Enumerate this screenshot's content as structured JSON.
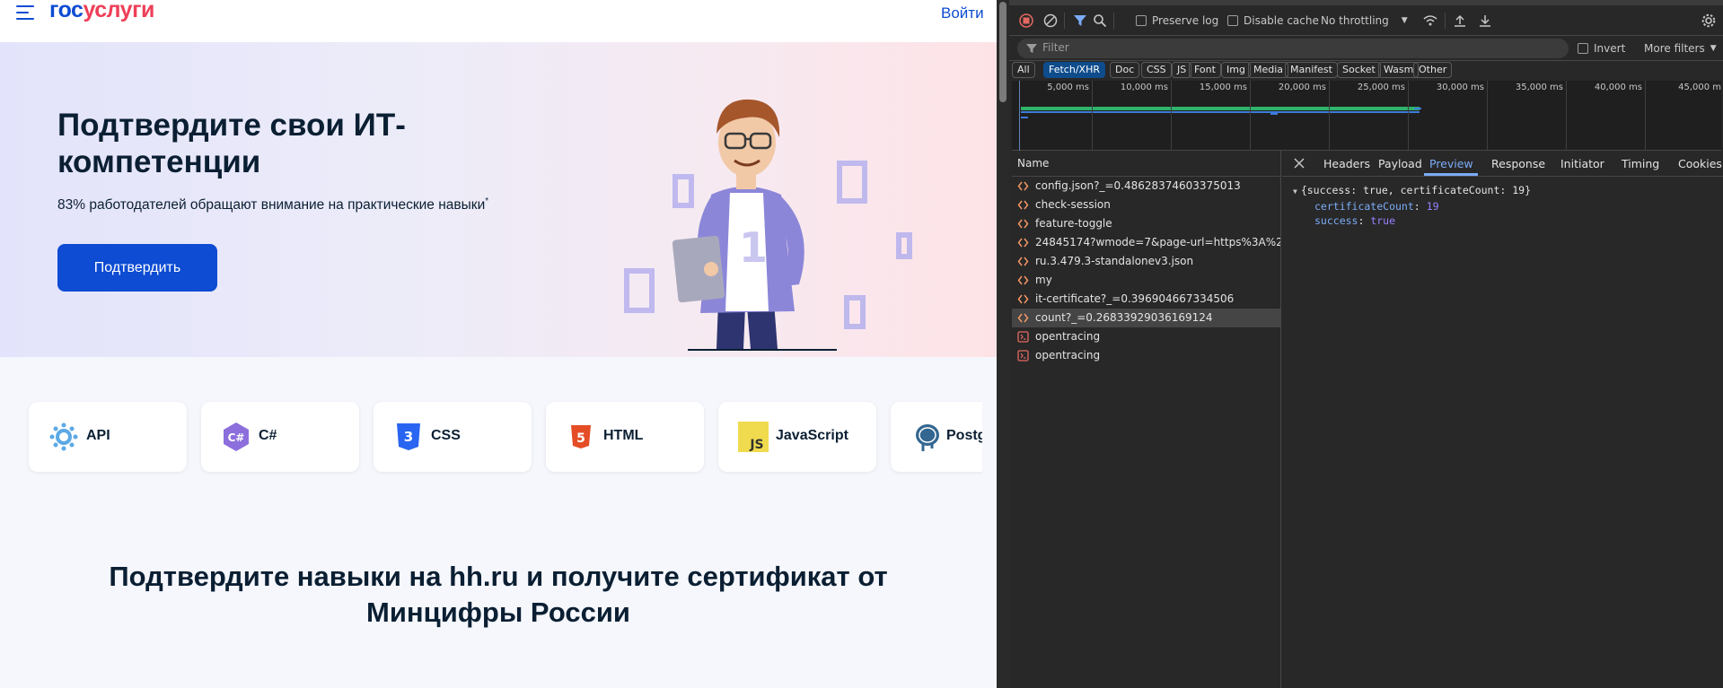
{
  "site": {
    "logo_part1": "гос",
    "logo_part2": "услуги",
    "login": "Войти"
  },
  "hero": {
    "title": "Подтвердите свои ИТ-компетенции",
    "subtitle": "83% работодателей обращают внимание на практические навыки",
    "subtitle_mark": "*",
    "confirm_button": "Подтвердить"
  },
  "skills": [
    {
      "label": "API",
      "icon": "api-icon",
      "color": "#5aa9e6"
    },
    {
      "label": "C#",
      "icon": "csharp-icon",
      "color": "#8c6fdc"
    },
    {
      "label": "CSS",
      "icon": "css-icon",
      "color": "#2965f1"
    },
    {
      "label": "HTML",
      "icon": "html-icon",
      "color": "#e44d26"
    },
    {
      "label": "JavaScript",
      "icon": "javascript-icon",
      "color": "#f0db4f"
    },
    {
      "label": "Postg",
      "icon": "postgresql-icon",
      "color": "#336791"
    }
  ],
  "section_title": "Подтвердите навыки на hh.ru и получите сертификат от Минцифры России",
  "devtools": {
    "toolbar": {
      "preserve_log": "Preserve log",
      "disable_cache": "Disable cache",
      "throttling": "No throttling"
    },
    "filter": {
      "placeholder": "Filter",
      "invert": "Invert",
      "more_filters": "More filters"
    },
    "types": [
      "All",
      "Fetch/XHR",
      "Doc",
      "CSS",
      "JS",
      "Font",
      "Img",
      "Media",
      "Manifest",
      "Socket",
      "Wasm",
      "Other"
    ],
    "selected_type": "Fetch/XHR",
    "timeline_ticks": [
      "5,000 ms",
      "10,000 ms",
      "15,000 ms",
      "20,000 ms",
      "25,000 ms",
      "30,000 ms",
      "35,000 ms",
      "40,000 ms",
      "45,000 m"
    ],
    "requests_header": "Name",
    "requests": [
      {
        "name": "config.json?_=0.48628374603375013",
        "kind": "xhr"
      },
      {
        "name": "check-session",
        "kind": "xhr"
      },
      {
        "name": "feature-toggle",
        "kind": "xhr"
      },
      {
        "name": "24845174?wmode=7&page-url=https%3A%2F%2...",
        "kind": "xhr"
      },
      {
        "name": "ru.3.479.3-standalonev3.json",
        "kind": "xhr"
      },
      {
        "name": "my",
        "kind": "xhr"
      },
      {
        "name": "it-certificate?_=0.396904667334506",
        "kind": "xhr"
      },
      {
        "name": "count?_=0.26833929036169124",
        "kind": "xhr"
      },
      {
        "name": "opentracing",
        "kind": "fetch"
      },
      {
        "name": "opentracing",
        "kind": "fetch"
      }
    ],
    "selected_request": "count?_=0.26833929036169124",
    "detail_tabs": [
      "Headers",
      "Payload",
      "Preview",
      "Response",
      "Initiator",
      "Timing",
      "Cookies"
    ],
    "selected_detail_tab": "Preview",
    "preview": {
      "summary": "{success: true, certificateCount: 19}",
      "line1_key": "certificateCount",
      "line1_val": "19",
      "line2_key": "success",
      "line2_val": "true"
    }
  }
}
